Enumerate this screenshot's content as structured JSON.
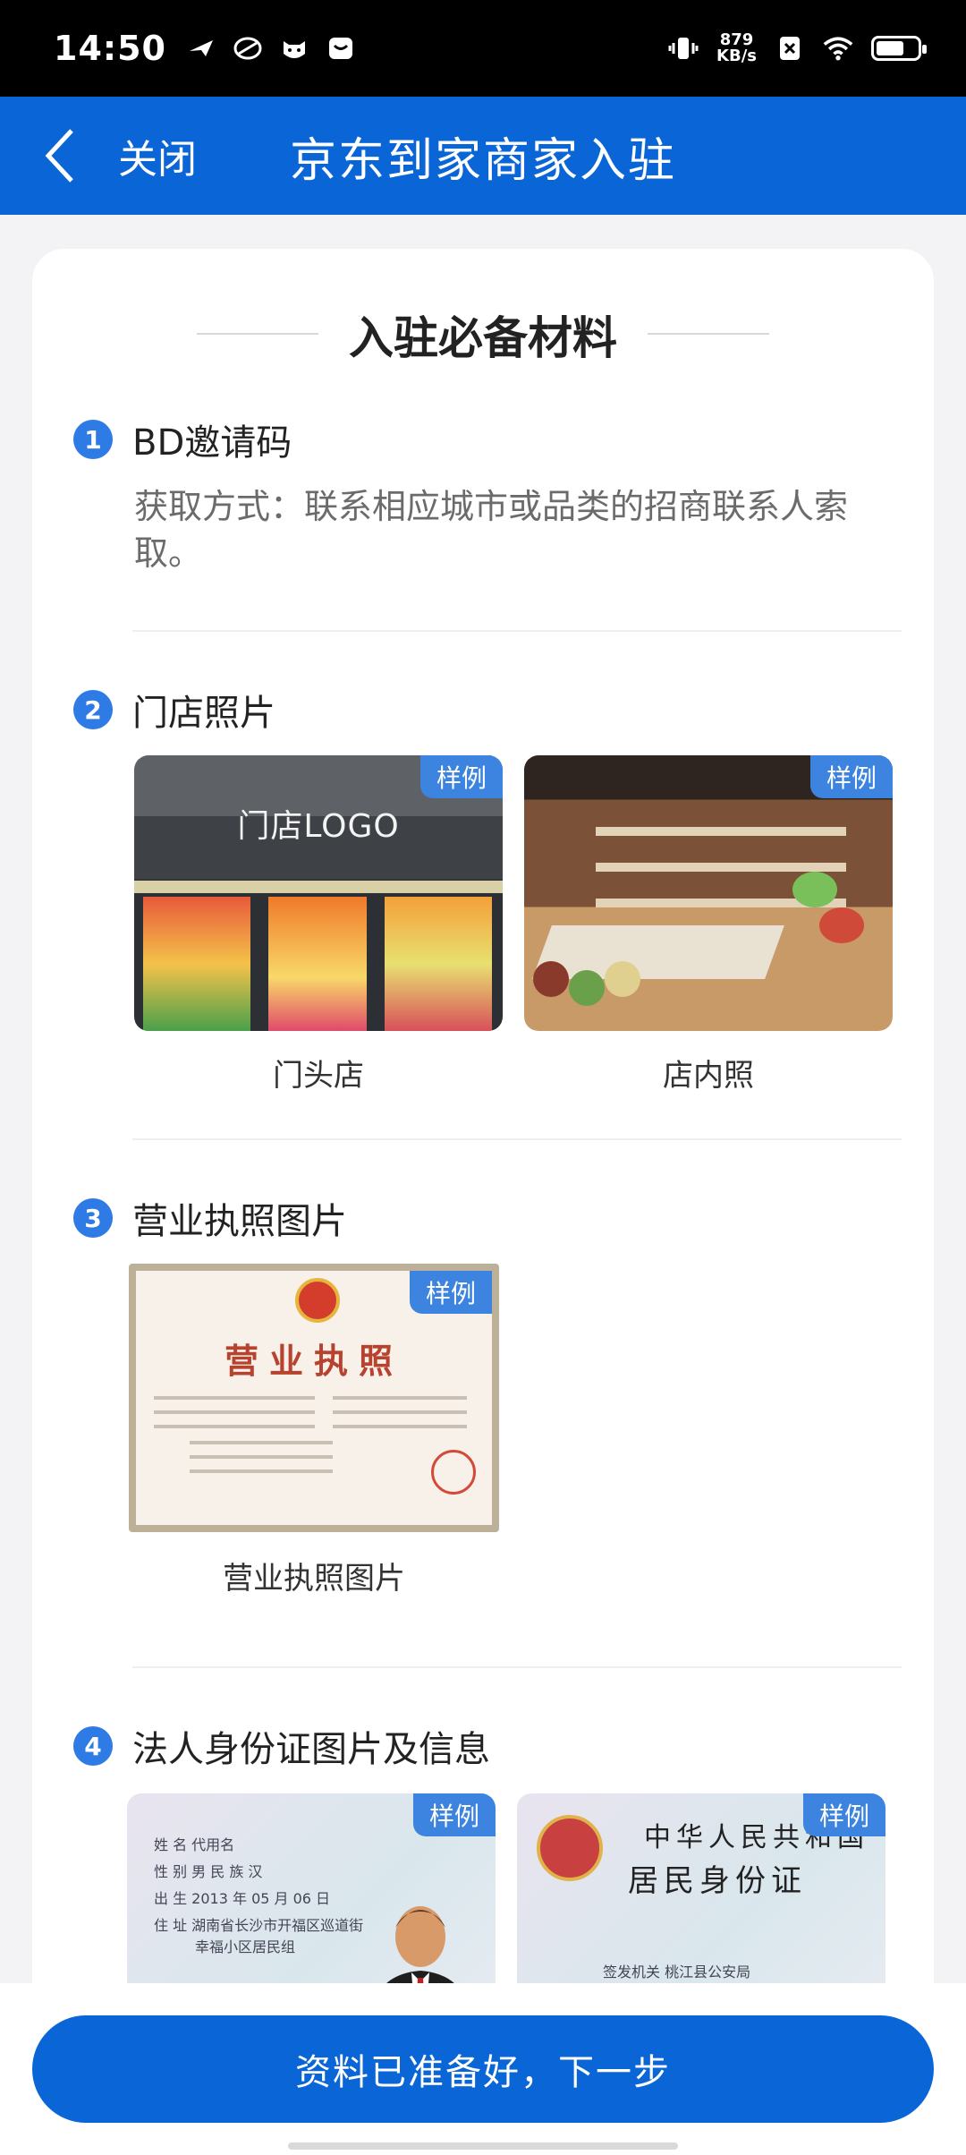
{
  "status_bar": {
    "time": "14:50",
    "speed_value": "879",
    "speed_unit": "KB/s"
  },
  "header": {
    "close_label": "关闭",
    "title": "京东到家商家入驻"
  },
  "card": {
    "title": "入驻必备材料",
    "sample_tag": "样例",
    "steps": [
      {
        "number": "1",
        "title": "BD邀请码",
        "desc": "获取方式：联系相应城市或品类的招商联系人索取。"
      },
      {
        "number": "2",
        "title": "门店照片",
        "photos": [
          {
            "caption": "门头店",
            "overlay": "门店LOGO"
          },
          {
            "caption": "店内照"
          }
        ]
      },
      {
        "number": "3",
        "title": "营业执照图片",
        "photos": [
          {
            "caption": "营业执照图片",
            "overlay": "营业执照"
          }
        ]
      },
      {
        "number": "4",
        "title": "法人身份证图片及信息",
        "photos": [
          {
            "lines": [
              "姓 名  代用名",
              "性 别  男    民 族  汉",
              "出 生  2013 年 05 月 06 日",
              "住 址  湖南省长沙市开福区巡道街",
              "幸福小区居民组"
            ]
          },
          {
            "lines": [
              "中华人民共和国",
              "居民身份证",
              "签发机关   桃江县公安局"
            ]
          }
        ]
      }
    ]
  },
  "bottom": {
    "next_label": "资料已准备好，下一步"
  }
}
